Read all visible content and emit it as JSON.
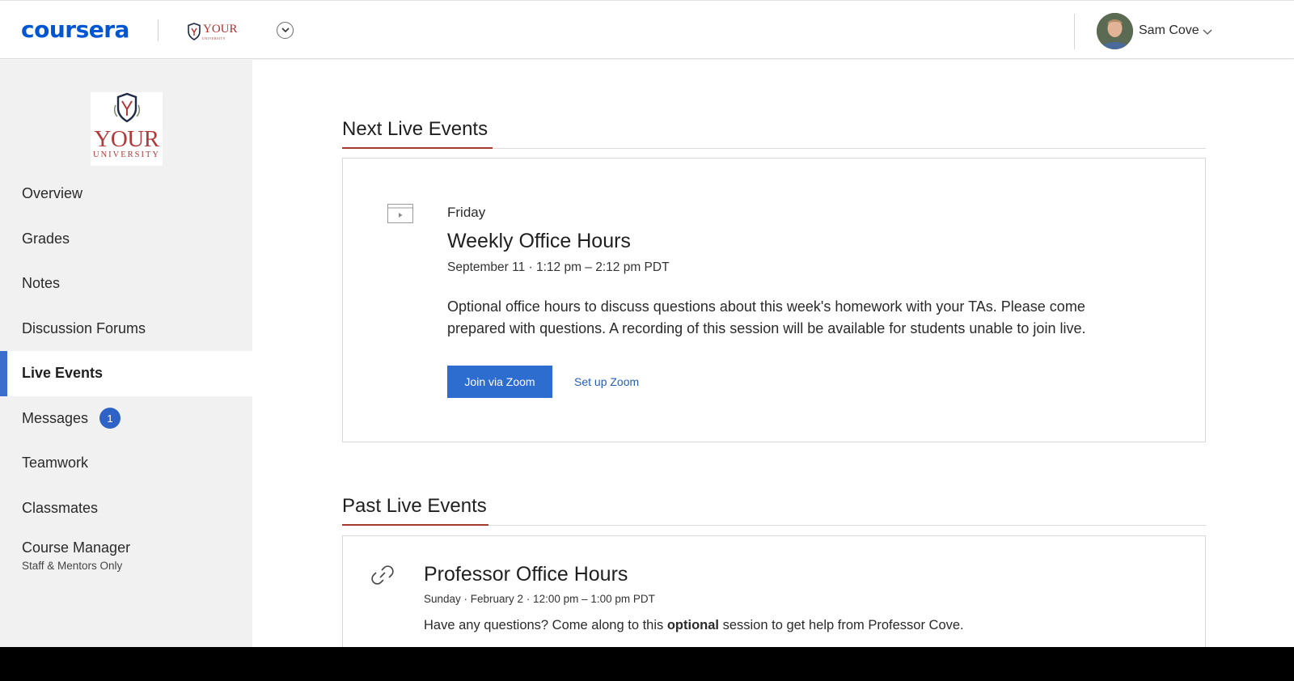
{
  "header": {
    "brand": "coursera",
    "university_short": "YOUR",
    "university_short_sub": "UNIVERSITY",
    "user_name": "Sam Cove"
  },
  "sidebar": {
    "logo_word": "YOUR",
    "logo_sub": "UNIVERSITY",
    "items": [
      {
        "label": "Overview"
      },
      {
        "label": "Grades"
      },
      {
        "label": "Notes"
      },
      {
        "label": "Discussion Forums"
      },
      {
        "label": "Live Events"
      },
      {
        "label": "Messages",
        "badge": "1"
      },
      {
        "label": "Teamwork"
      },
      {
        "label": "Classmates"
      },
      {
        "label": "Course Manager",
        "sub": "Staff & Mentors Only"
      }
    ]
  },
  "next_events": {
    "heading": "Next Live Events",
    "event": {
      "day": "Friday",
      "title": "Weekly Office Hours",
      "time": "September 11 · 1:12 pm – 2:12 pm PDT",
      "description": "Optional office hours to discuss questions about this week's homework with your TAs. Please come prepared with questions. A recording of this session will be available for students unable to join live.",
      "join_label": "Join via Zoom",
      "setup_label": "Set up Zoom"
    }
  },
  "past_events": {
    "heading": "Past Live Events",
    "event": {
      "title": "Professor Office Hours",
      "time": "Sunday · February 2 · 12:00 pm – 1:00 pm PDT",
      "desc_before": "Have any questions? Come along to this ",
      "desc_bold": "optional",
      "desc_after": " session to get help from Professor Cove."
    }
  },
  "colors": {
    "brand": "#0056d2",
    "accent_rule": "#a33c2c",
    "active_bar": "#3a6fcd",
    "button": "#2e6dd0",
    "university_red": "#b23a3a"
  }
}
